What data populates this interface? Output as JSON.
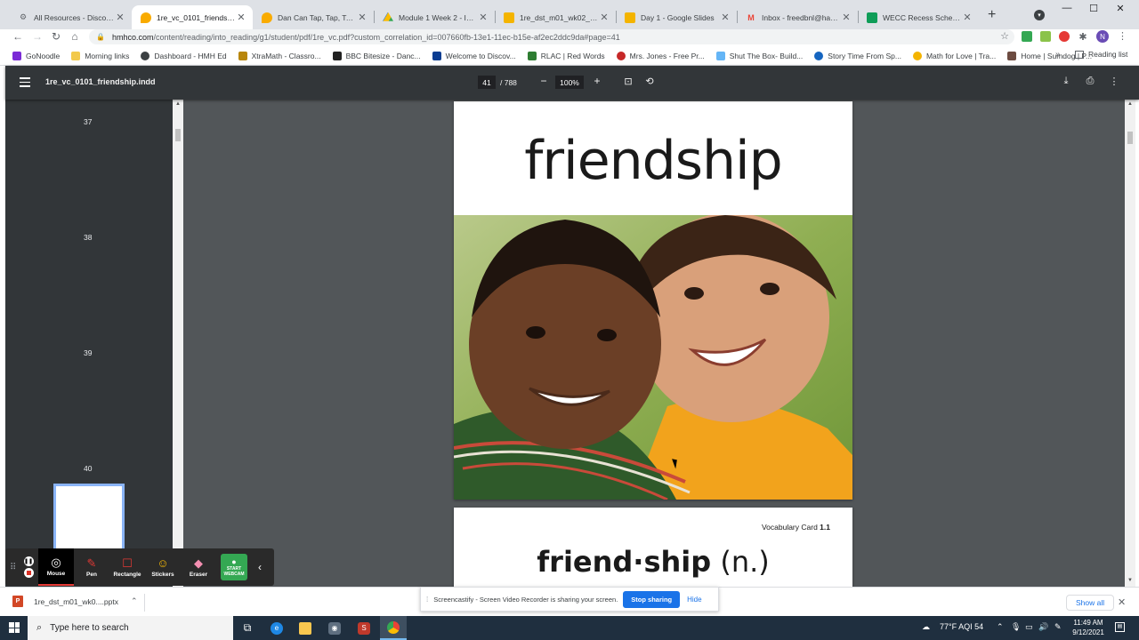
{
  "browser": {
    "tabs": [
      {
        "title": "All Resources - Discover - ",
        "icon": "gear-favicon",
        "active": false
      },
      {
        "title": "1re_vc_0101_friendship.ind",
        "icon": "hmh-favicon",
        "active": true
      },
      {
        "title": "Dan Can Tap, Tap, Tap - HM",
        "icon": "hmh-favicon",
        "active": false
      },
      {
        "title": "Module 1 Week 2 - Into Re",
        "icon": "drive-favicon",
        "active": false
      },
      {
        "title": "1re_dst_m01_wk02_l06 (2).",
        "icon": "slides-favicon",
        "active": false
      },
      {
        "title": "Day 1 - Google Slides",
        "icon": "slides-favicon",
        "active": false
      },
      {
        "title": "Inbox - freedbnl@haslett.k",
        "icon": "gmail-favicon",
        "active": false
      },
      {
        "title": "WECC Recess Schedule 21",
        "icon": "sheets-favicon",
        "active": false
      }
    ],
    "new_tab_glyph": "+",
    "window_controls": {
      "minimize": "—",
      "maximize": "☐",
      "close": "✕"
    },
    "url_host": "hmhco.com",
    "url_path": "/content/reading/into_reading/g1/student/pdf/1re_vc.pdf?custom_correlation_id=007660fb-13e1-11ec-b15e-af2ec2ddc9da#page=41",
    "profile_initial": "N",
    "bookmarks": [
      {
        "label": "GoNoodle",
        "color": "#7b2bd6"
      },
      {
        "label": "Morning links",
        "color": "#f2c94c"
      },
      {
        "label": "Dashboard - HMH Ed",
        "color": "#3c4043"
      },
      {
        "label": "XtraMath - Classro...",
        "color": "#b8860b"
      },
      {
        "label": "BBC Bitesize - Danc...",
        "color": "#222222"
      },
      {
        "label": "Welcome to Discov...",
        "color": "#0b3d91"
      },
      {
        "label": "RLAC | Red Words",
        "color": "#2e7d32"
      },
      {
        "label": "Mrs. Jones - Free Pr...",
        "color": "#c62828"
      },
      {
        "label": "Shut The Box- Build...",
        "color": "#64b5f6"
      },
      {
        "label": "Story Time From Sp...",
        "color": "#1565c0"
      },
      {
        "label": "Math for Love | Tra...",
        "color": "#f4b400"
      },
      {
        "label": "Home | Sumdog | P...",
        "color": "#6d4c41"
      }
    ],
    "bookmarks_more": "»",
    "reading_list": "Reading list"
  },
  "pdf": {
    "filename": "1re_vc_0101_friendship.indd",
    "current_page": "41",
    "page_total": "/ 788",
    "zoom": "100%",
    "zoom_out": "−",
    "zoom_in": "+",
    "thumbnail_numbers": [
      "37",
      "38",
      "39",
      "40"
    ],
    "page1_word": "friendship",
    "page2_label": "Vocabulary Card",
    "page2_number": "1.1",
    "page2_syllables": "friend·ship",
    "page2_pos": "(n.)"
  },
  "screencastify": {
    "tools": [
      {
        "label": "Mouse",
        "icon": "mouse-icon",
        "active": true
      },
      {
        "label": "Pen",
        "icon": "pen-icon",
        "active": false
      },
      {
        "label": "Rectangle",
        "icon": "rectangle-icon",
        "active": false
      },
      {
        "label": "Stickers",
        "icon": "stickers-icon",
        "active": false
      },
      {
        "label": "Eraser",
        "icon": "eraser-icon",
        "active": false
      }
    ],
    "webcam_label_1": "START",
    "webcam_label_2": "WEBCAM",
    "share_message": "Screencastify - Screen Video Recorder is sharing your screen.",
    "stop_sharing": "Stop sharing",
    "hide": "Hide"
  },
  "downloads": {
    "file": "1re_dst_m01_wk0....pptx",
    "file_icon_letter": "P",
    "show_all": "Show all"
  },
  "taskbar": {
    "search_placeholder": "Type here to search",
    "weather": "77°F  AQI 54",
    "time": "11:49 AM",
    "date": "9/12/2021"
  },
  "colors": {
    "tabstrip": "#dee1e6",
    "pdf_toolbar": "#323639",
    "viewer_bg": "#525659",
    "accent_blue": "#1a73e8",
    "taskbar": "#1f2f3f",
    "webcam_green": "#34a853"
  }
}
